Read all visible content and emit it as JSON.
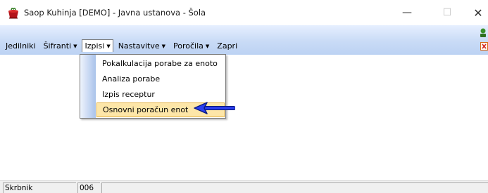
{
  "window": {
    "title": "Saop Kuhinja [DEMO] - Javna ustanova - Šola",
    "minimize_label": "—",
    "maximize_label": "☐",
    "close_label": "✕"
  },
  "menu": {
    "items": [
      {
        "label": "Jedilniki",
        "caret": ""
      },
      {
        "label": "Šifranti",
        "caret": "▼"
      },
      {
        "label": "Izpisi",
        "caret": "▼"
      },
      {
        "label": "Nastavitve",
        "caret": "▼"
      },
      {
        "label": "Poročila",
        "caret": "▼"
      },
      {
        "label": "Zapri",
        "caret": ""
      }
    ]
  },
  "dropdown": {
    "items": [
      {
        "label": "Pokalkulacija porabe za enoto"
      },
      {
        "label": "Analiza porabe"
      },
      {
        "label": "Izpis receptur"
      },
      {
        "label": "Osnovni poračun enot"
      }
    ]
  },
  "colors": {
    "highlight": "#fde6a8",
    "arrow": "#1a2fe0",
    "menu_band": "#c9dbf6"
  },
  "status": {
    "user": "Skrbnik",
    "code": "006",
    "rest": ""
  }
}
